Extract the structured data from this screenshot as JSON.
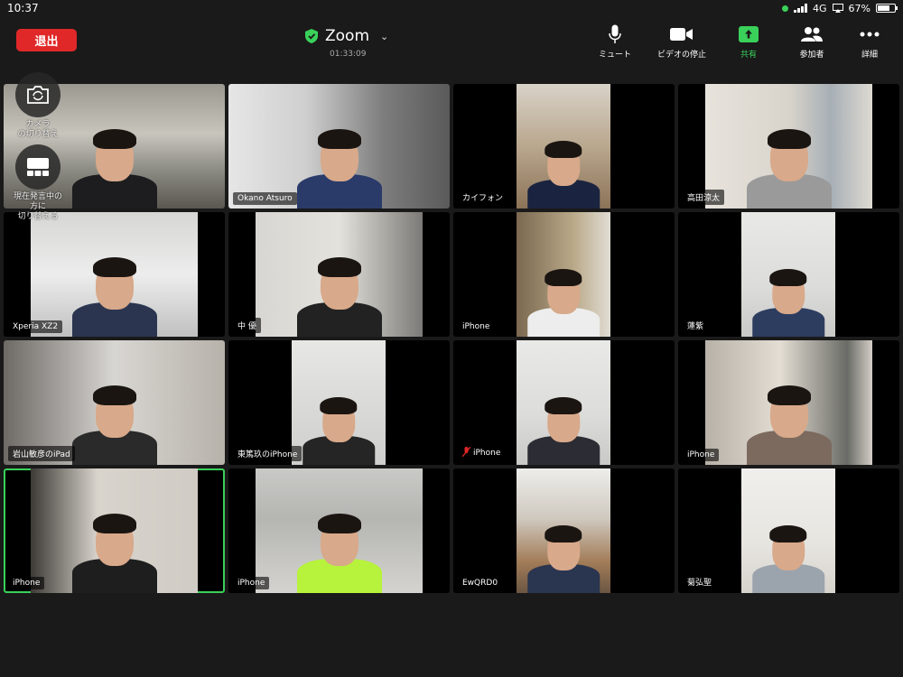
{
  "status": {
    "time": "10:37",
    "network": "4G",
    "battery": "67%",
    "battery_level": 0.67
  },
  "toolbar": {
    "leave_label": "退出",
    "meeting_title": "Zoom",
    "timer": "01:33:09",
    "mute_label": "ミュート",
    "video_label": "ビデオの停止",
    "share_label": "共有",
    "participants_label": "参加者",
    "more_label": "詳細"
  },
  "side": {
    "camera_label": "カメラ\nの切り替え",
    "view_label": "現在発言中の\n方に\n切り替える"
  },
  "colors": {
    "accent": "#3ad15a",
    "leave": "#e02828",
    "background": "#1a1a1a"
  },
  "tiles": [
    {
      "name": "",
      "scene": "room"
    },
    {
      "name": "Okano Atsuro",
      "scene": "office"
    },
    {
      "name": "カイフォン",
      "scene": "bed"
    },
    {
      "name": "高田涼太",
      "scene": "curtain"
    },
    {
      "name": "Xperia XZ2",
      "scene": "wall"
    },
    {
      "name": "中 優",
      "scene": "shelf"
    },
    {
      "name": "iPhone",
      "scene": "closet"
    },
    {
      "name": "蓮紫",
      "scene": "plain"
    },
    {
      "name": "岩山敏彦のiPad",
      "scene": "hanger"
    },
    {
      "name": "東篤玖のiPhone",
      "scene": "dark"
    },
    {
      "name": "iPhone",
      "scene": "plain",
      "muted": true
    },
    {
      "name": "iPhone",
      "scene": "jackets"
    },
    {
      "name": "iPhone",
      "scene": "closet2",
      "active": true
    },
    {
      "name": "iPhone",
      "scene": "ceiling"
    },
    {
      "name": "EwQRD0",
      "scene": "door"
    },
    {
      "name": "菊弘聖",
      "scene": "lowplain"
    }
  ]
}
